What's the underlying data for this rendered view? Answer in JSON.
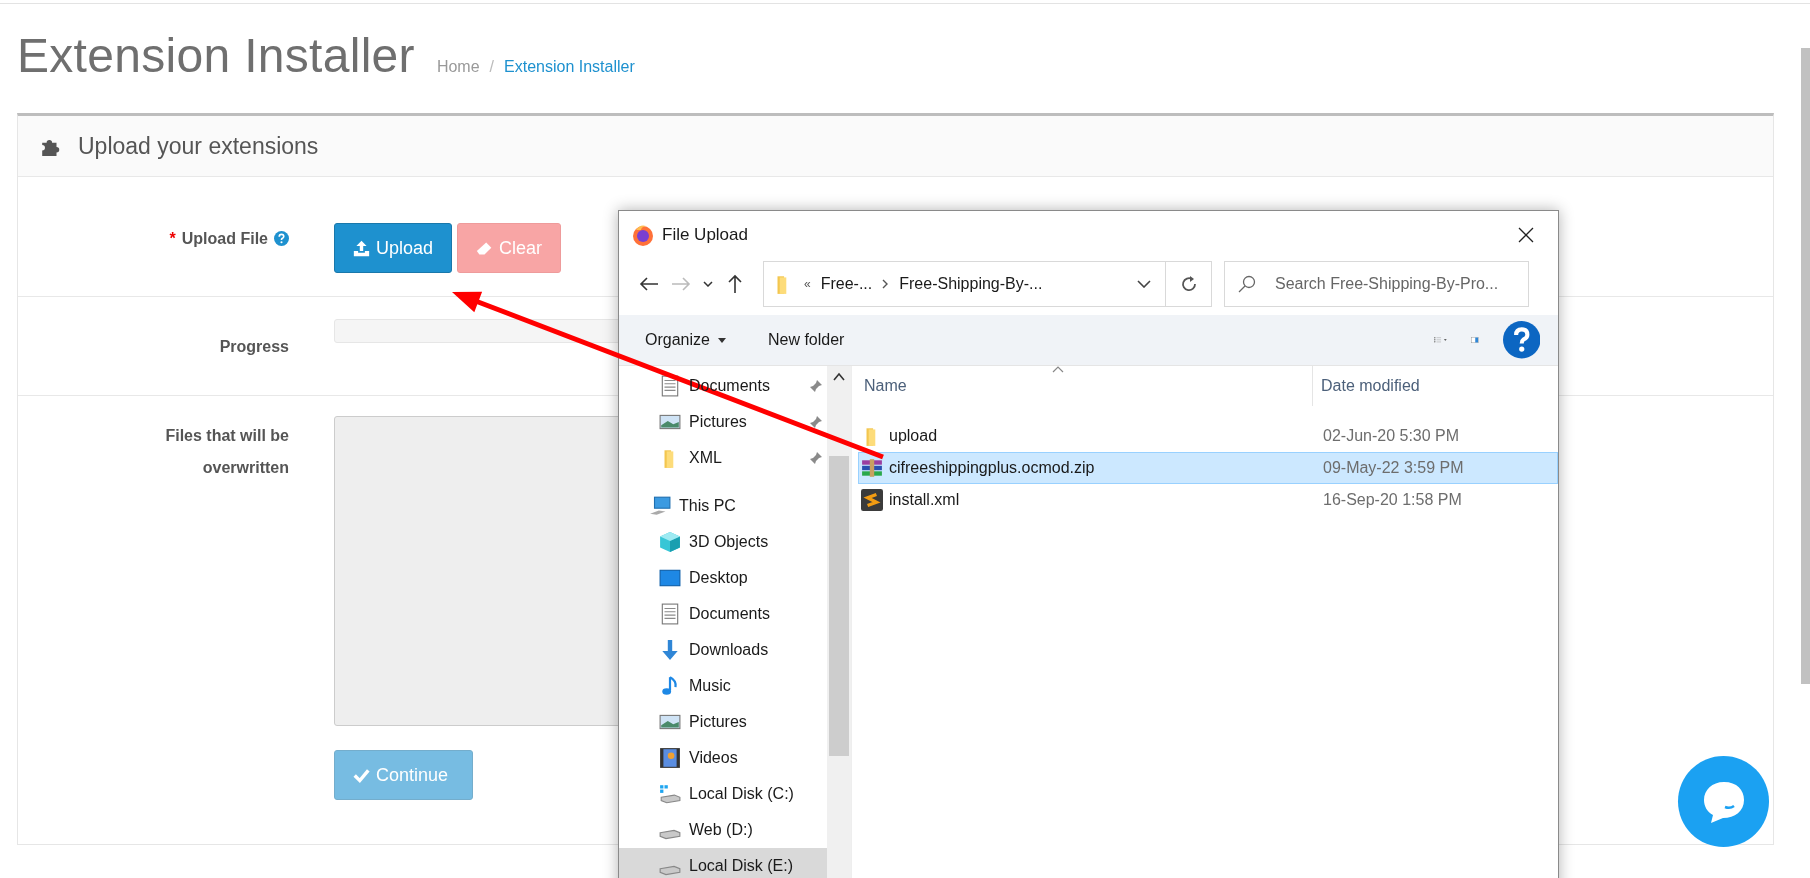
{
  "page": {
    "title": "Extension Installer",
    "breadcrumb_separator": "/",
    "breadcrumb": [
      {
        "label": "Home",
        "selected": false
      },
      {
        "label": "Extension Installer",
        "selected": true
      }
    ]
  },
  "panel": {
    "title": "Upload your extensions",
    "upload": {
      "required_mark": "*",
      "label": "Upload File",
      "buttons": [
        {
          "label": "Upload",
          "kind": "primary",
          "disabled": false
        },
        {
          "label": "Clear",
          "kind": "danger",
          "disabled": true
        }
      ]
    },
    "progress": {
      "label": "Progress",
      "level": 0
    },
    "files": {
      "label": "Files that will be overwritten"
    },
    "continue": {
      "label": "Continue",
      "disabled": true
    }
  },
  "dialog": {
    "title": "File Upload",
    "path_overflow": "«",
    "path": [
      "Free-...",
      "Free-Shipping-By-..."
    ],
    "search": {
      "placeholder": "Search Free-Shipping-By-Pro..."
    },
    "toolbar": [
      "Organize",
      "New folder"
    ],
    "nav": [
      {
        "label": "Documents",
        "kind": "documents",
        "pinned": true,
        "selected": false
      },
      {
        "label": "Pictures",
        "kind": "pictures",
        "pinned": true,
        "selected": false
      },
      {
        "label": "XML",
        "kind": "folder",
        "pinned": true,
        "selected": false
      },
      {
        "label": "This PC",
        "kind": "pc",
        "pinned": false,
        "selected": false,
        "children": [
          {
            "label": "3D Objects",
            "kind": "cube",
            "pinned": false,
            "selected": false
          },
          {
            "label": "Desktop",
            "kind": "desktop",
            "pinned": false,
            "selected": false
          },
          {
            "label": "Documents",
            "kind": "documents",
            "pinned": false,
            "selected": false
          },
          {
            "label": "Downloads",
            "kind": "downloads",
            "pinned": false,
            "selected": false
          },
          {
            "label": "Music",
            "kind": "music",
            "pinned": false,
            "selected": false
          },
          {
            "label": "Pictures",
            "kind": "pictures",
            "pinned": false,
            "selected": false
          },
          {
            "label": "Videos",
            "kind": "videos",
            "pinned": false,
            "selected": false
          },
          {
            "label": "Local Disk (C:)",
            "kind": "system-drive",
            "pinned": false,
            "selected": false
          },
          {
            "label": "Web (D:)",
            "kind": "drive",
            "pinned": false,
            "selected": false
          },
          {
            "label": "Local Disk (E:)",
            "kind": "drive",
            "pinned": false,
            "selected": true
          }
        ]
      }
    ],
    "columns": [
      "Name",
      "Date modified"
    ],
    "files": [
      {
        "name": "upload",
        "date": "02-Jun-20 5:30 PM",
        "kind": "folder",
        "selected": false
      },
      {
        "name": "cifreeshippingplus.ocmod.zip",
        "date": "09-May-22 3:59 PM",
        "kind": "archive",
        "selected": true
      },
      {
        "name": "install.xml",
        "date": "16-Sep-20 1:58 PM",
        "kind": "script",
        "selected": false
      }
    ]
  }
}
